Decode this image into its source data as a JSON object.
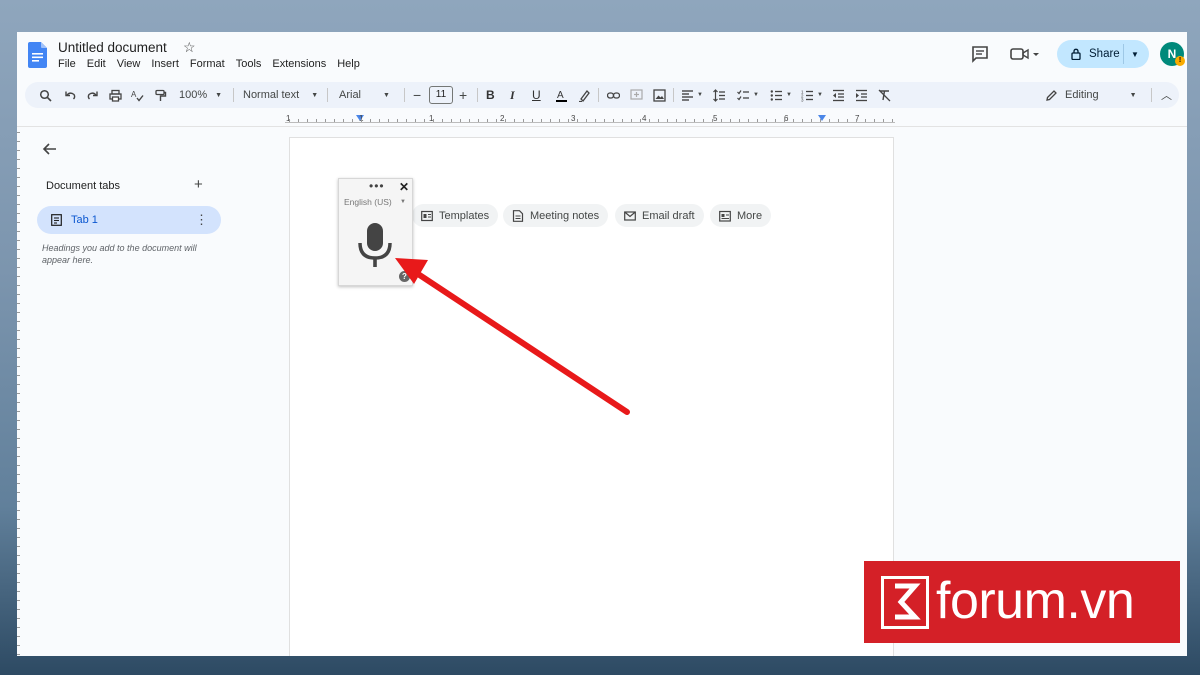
{
  "document": {
    "title": "Untitled document",
    "menu": [
      "File",
      "Edit",
      "View",
      "Insert",
      "Format",
      "Tools",
      "Extensions",
      "Help"
    ]
  },
  "header": {
    "share_label": "Share",
    "avatar_letter": "N",
    "warning_glyph": "!"
  },
  "toolbar": {
    "zoom": "100%",
    "style": "Normal text",
    "font": "Arial",
    "font_size": "11",
    "mode": "Editing"
  },
  "ruler": {
    "numbers": [
      "1",
      "1",
      "1",
      "2",
      "3",
      "4",
      "5",
      "6",
      "7"
    ]
  },
  "sidebar": {
    "heading": "Document tabs",
    "tabs": [
      {
        "label": "Tab 1"
      }
    ],
    "hint": "Headings you add to the document will appear here."
  },
  "chips": [
    {
      "label": "Templates",
      "icon": "templates-icon"
    },
    {
      "label": "Meeting notes",
      "icon": "document-icon"
    },
    {
      "label": "Email draft",
      "icon": "email-icon"
    },
    {
      "label": "More",
      "icon": "more-icon"
    }
  ],
  "voice_typing": {
    "language": "English (US)",
    "info_glyph": "?"
  },
  "watermark": {
    "text": "forum.vn"
  },
  "colors": {
    "accent": "#0b57d0",
    "share_bg": "#c2e7ff",
    "tab_active_bg": "#d3e3fd",
    "arrow": "#e8191a",
    "watermark_bg": "#d42027"
  }
}
